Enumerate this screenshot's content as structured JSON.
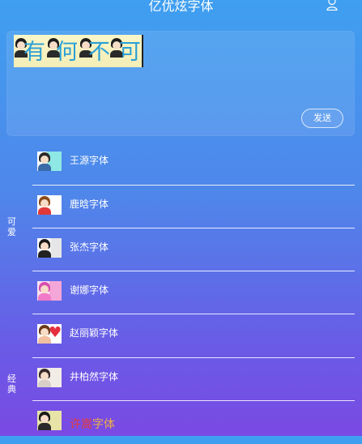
{
  "header": {
    "title": "亿优炫字体"
  },
  "editor": {
    "preview_chars": [
      "有",
      "何",
      "不",
      "可"
    ],
    "send_label": "发送"
  },
  "categories": [
    {
      "label": "可爱"
    },
    {
      "label": "经典"
    }
  ],
  "fonts": [
    {
      "label": "王源字体",
      "thumb_colors": [
        "#2a2a2a",
        "#8ee8e4"
      ]
    },
    {
      "label": "鹿晗字体",
      "thumb_colors": [
        "#8a4a1a",
        "#e23a3a"
      ]
    },
    {
      "label": "张杰字体",
      "thumb_colors": [
        "#1a1a1a",
        "#d0d0d0"
      ]
    },
    {
      "label": "谢娜字体",
      "thumb_colors": [
        "#d84fae",
        "#f5a6d8"
      ]
    },
    {
      "label": "赵丽颖字体",
      "thumb_colors": [
        "#6a3a1a",
        "#e53040"
      ]
    },
    {
      "label": "井柏然字体",
      "thumb_colors": [
        "#3a2a2a",
        "#e0d8d0"
      ]
    },
    {
      "label": "许嵩字体",
      "thumb_colors": [
        "#1a1a1a",
        "#e8e4a8"
      ],
      "label_colors": [
        "#e83a3a",
        "#e83a3a",
        "#f0b040",
        "#f0b040"
      ]
    }
  ]
}
